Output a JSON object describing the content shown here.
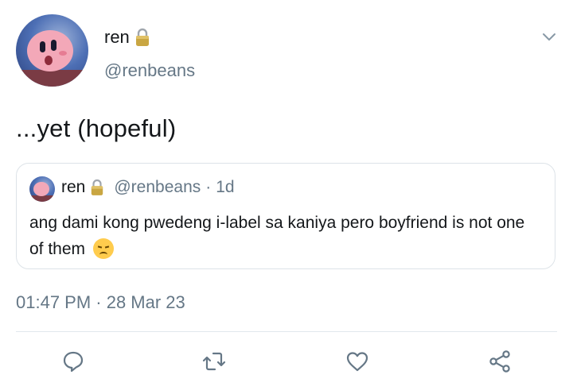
{
  "author": {
    "name": "ren",
    "handle": "@renbeans",
    "locked_icon": "lock-icon"
  },
  "tweet": {
    "text": "...yet (hopeful)",
    "timestamp": "01:47 PM · 28 Mar 23"
  },
  "quoted": {
    "name": "ren",
    "handle": "@renbeans",
    "separator": "·",
    "time": "1d",
    "text_line": "ang dami kong pwedeng i-label sa kaniya pero boyfriend is not one of them",
    "emoji": "disappointed-face"
  },
  "actions": {
    "reply": "reply-icon",
    "retweet": "retweet-icon",
    "like": "heart-icon",
    "share": "share-icon"
  },
  "colors": {
    "text": "#14171a",
    "secondary": "#657786",
    "icon": "#657786",
    "border": "#dde3e8"
  }
}
